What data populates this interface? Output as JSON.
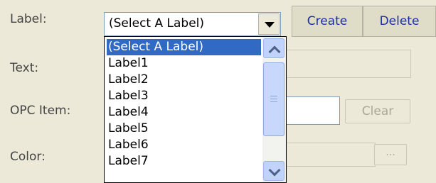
{
  "form": {
    "label_caption": "Label:",
    "text_caption": "Text:",
    "opc_caption": "OPC Item:",
    "color_caption": "Color:"
  },
  "label_select": {
    "value": "(Select A Label)",
    "options": [
      "(Select A Label)",
      "Label1",
      "Label2",
      "Label3",
      "Label4",
      "Label5",
      "Label6",
      "Label7"
    ],
    "selected_index": 0
  },
  "buttons": {
    "create": "Create",
    "delete": "Delete",
    "clear": "Clear",
    "color_browse": "..."
  },
  "colors": {
    "window_bg": "#ece9d8",
    "selection": "#316ac5",
    "button_text": "#1c2fa6"
  }
}
